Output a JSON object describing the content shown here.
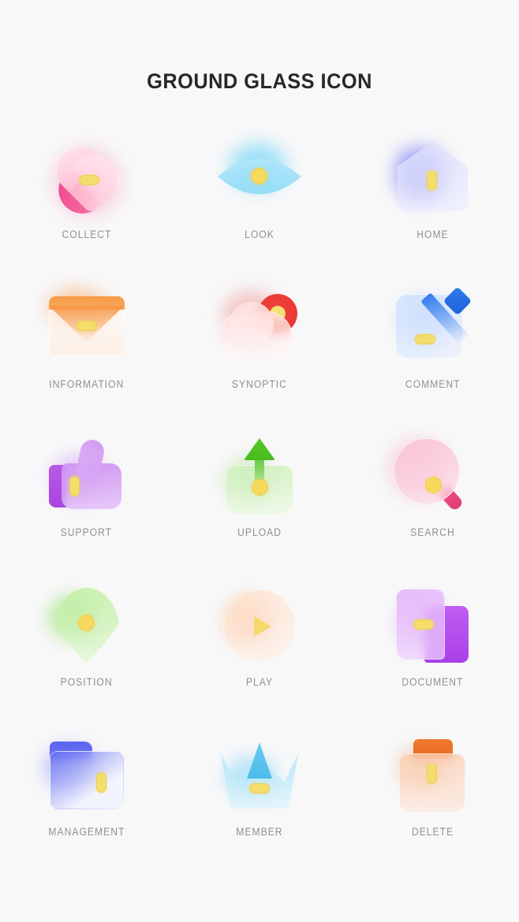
{
  "page": {
    "title": "GROUND GLASS ICON",
    "background_color": "#f8f8f9",
    "title_color": "#26282b",
    "label_color": "#909094",
    "accent_yellow": "#f5dd6b"
  },
  "grid": {
    "columns": 3,
    "rows": 5,
    "items": [
      {
        "label": "COLLECT",
        "icon": "heart-icon",
        "color": "#f0488b"
      },
      {
        "label": "LOOK",
        "icon": "eye-icon",
        "color": "#52cef5"
      },
      {
        "label": "HOME",
        "icon": "house-icon",
        "color": "#5052f5"
      },
      {
        "label": "INFORMATION",
        "icon": "envelope-icon",
        "color": "#f7963f"
      },
      {
        "label": "SYNOPTIC",
        "icon": "weather-sun-cloud-icon",
        "color": "#e8342f"
      },
      {
        "label": "COMMENT",
        "icon": "pencil-card-icon",
        "color": "#2f7bee"
      },
      {
        "label": "SUPPORT",
        "icon": "thumbs-up-icon",
        "color": "#b659e8"
      },
      {
        "label": "UPLOAD",
        "icon": "upload-arrow-icon",
        "color": "#4fc024"
      },
      {
        "label": "SEARCH",
        "icon": "magnifier-icon",
        "color": "#ed5185"
      },
      {
        "label": "POSITION",
        "icon": "map-pin-icon",
        "color": "#64d228"
      },
      {
        "label": "PLAY",
        "icon": "play-circle-icon",
        "color": "#f78c3c"
      },
      {
        "label": "DOCUMENT",
        "icon": "documents-icon",
        "color": "#ab3fe8"
      },
      {
        "label": "MANAGEMENT",
        "icon": "folder-icon",
        "color": "#5a64ef"
      },
      {
        "label": "MEMBER",
        "icon": "crown-icon",
        "color": "#4cbbe9"
      },
      {
        "label": "DELETE",
        "icon": "trash-can-icon",
        "color": "#ef7a2e"
      }
    ]
  }
}
